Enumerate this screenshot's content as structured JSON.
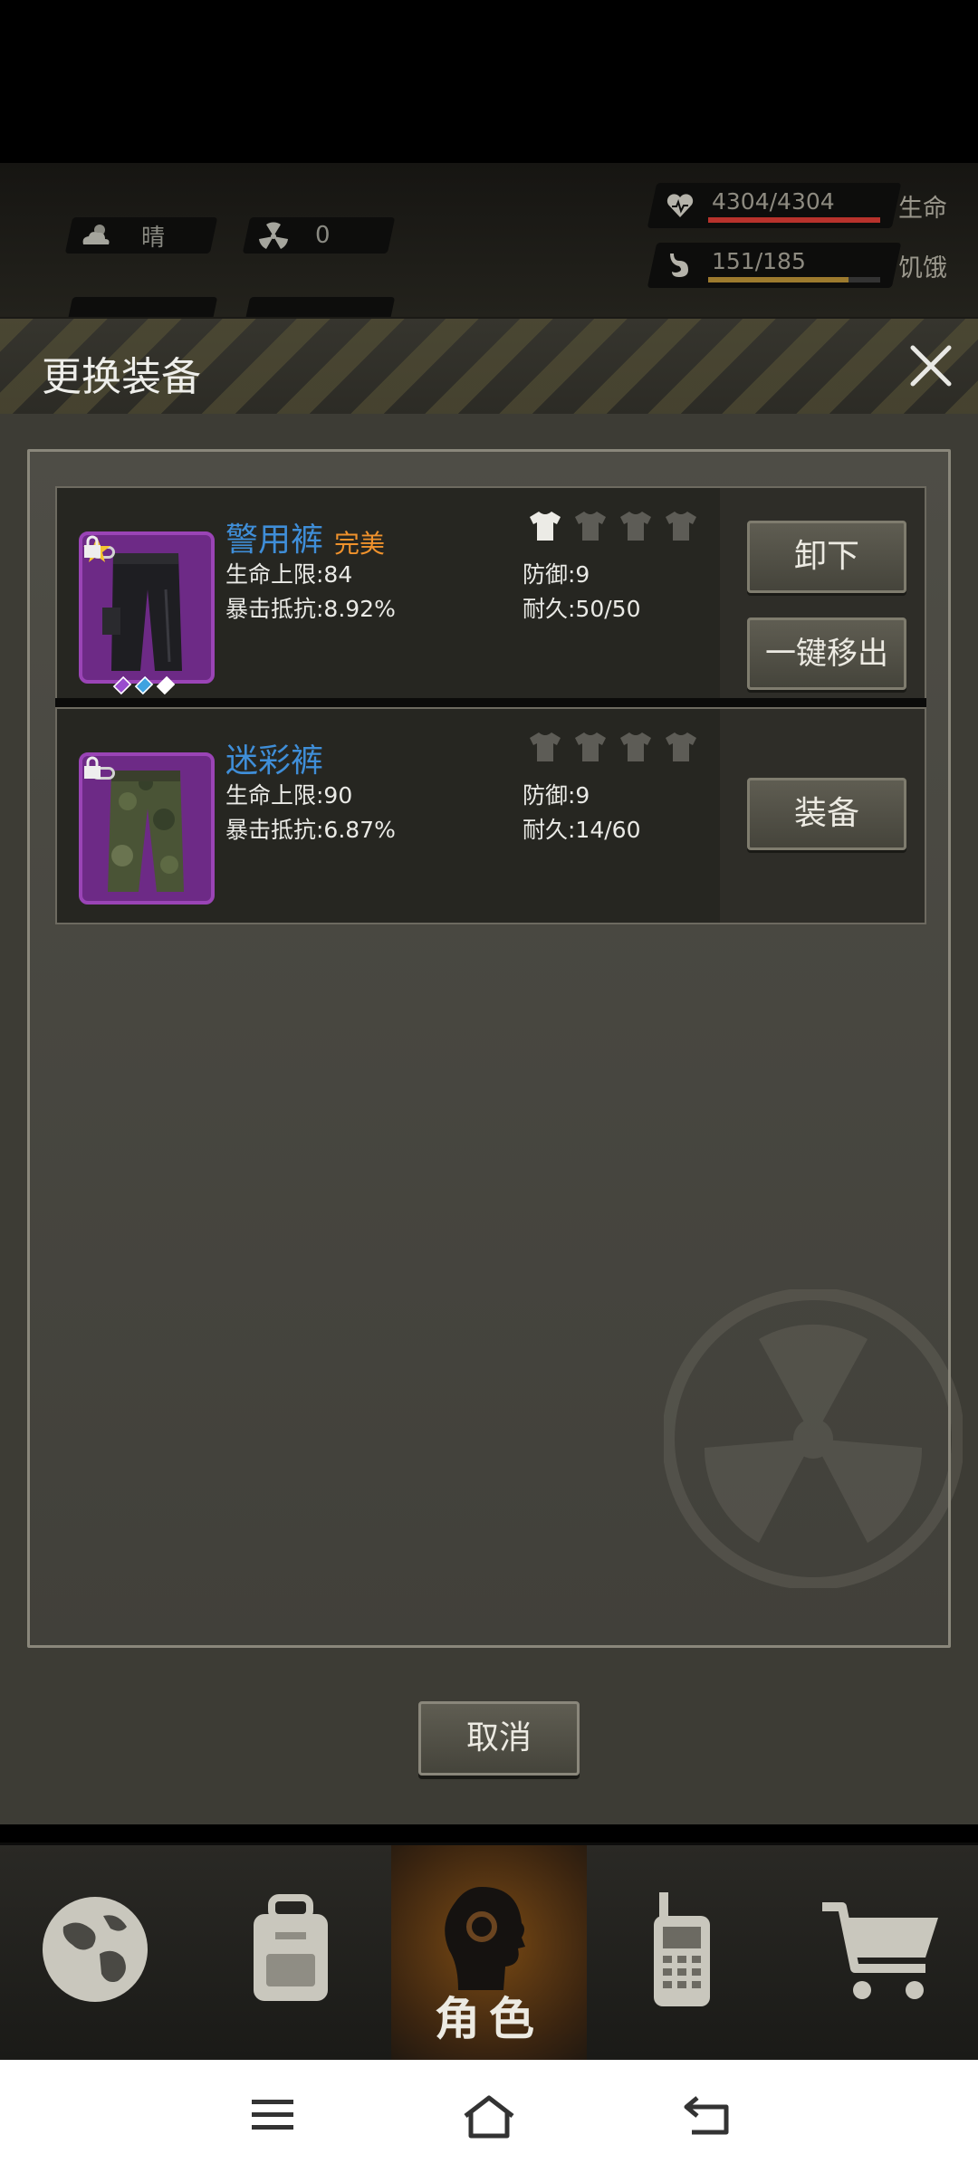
{
  "hud": {
    "weather_label": "晴",
    "radiation_value": "0",
    "health": {
      "value": "4304/4304",
      "label": "生命",
      "fraction": 1.0,
      "color": "#b8322c"
    },
    "hunger": {
      "value": "151/185",
      "label": "饥饿",
      "fraction": 0.816,
      "color": "#9c7a2e"
    }
  },
  "modal": {
    "title": "更换装备",
    "items": [
      {
        "name": "警用裤",
        "quality": "完美",
        "stat1": "生命上限:84",
        "stat2": "暴击抵抗:8.92%",
        "stat3": "防御:9",
        "stat4": "耐久:50/50",
        "buttons": [
          "卸下",
          "一键移出"
        ],
        "slots_filled": 1
      },
      {
        "name": "迷彩裤",
        "quality": "",
        "stat1": "生命上限:90",
        "stat2": "暴击抵抗:6.87%",
        "stat3": "防御:9",
        "stat4": "耐久:14/60",
        "buttons": [
          "装备"
        ],
        "slots_filled": 0
      }
    ],
    "cancel_label": "取消"
  },
  "tabs": [
    {
      "icon": "globe-icon",
      "label": ""
    },
    {
      "icon": "backpack-icon",
      "label": ""
    },
    {
      "icon": "character-head-icon",
      "label": "角色",
      "active": true
    },
    {
      "icon": "walkie-talkie-icon",
      "label": ""
    },
    {
      "icon": "cart-icon",
      "label": ""
    }
  ]
}
